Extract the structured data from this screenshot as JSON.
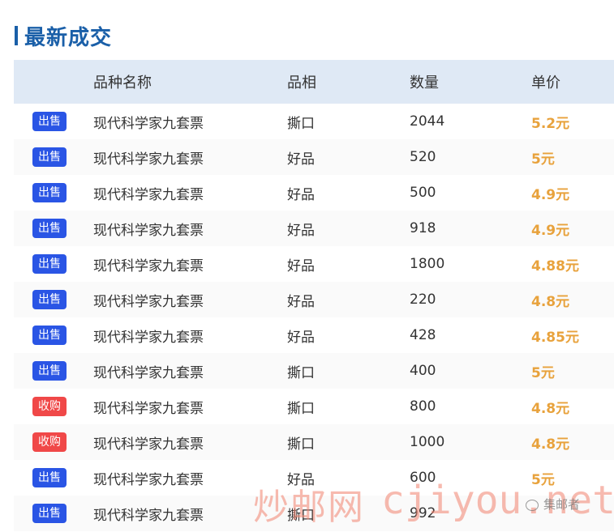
{
  "section": {
    "title": "最新成交"
  },
  "table": {
    "headers": [
      "",
      "品种名称",
      "品相",
      "数量",
      "单价"
    ],
    "rows": [
      {
        "type": "出售",
        "color": "#2a55e5",
        "name": "现代科学家九套票",
        "condition": "撕口",
        "qty": "2044",
        "price": "5.2元"
      },
      {
        "type": "出售",
        "color": "#2a55e5",
        "name": "现代科学家九套票",
        "condition": "好品",
        "qty": "520",
        "price": "5元"
      },
      {
        "type": "出售",
        "color": "#2a55e5",
        "name": "现代科学家九套票",
        "condition": "好品",
        "qty": "500",
        "price": "4.9元"
      },
      {
        "type": "出售",
        "color": "#2a55e5",
        "name": "现代科学家九套票",
        "condition": "好品",
        "qty": "918",
        "price": "4.9元"
      },
      {
        "type": "出售",
        "color": "#2a55e5",
        "name": "现代科学家九套票",
        "condition": "好品",
        "qty": "1800",
        "price": "4.88元"
      },
      {
        "type": "出售",
        "color": "#2a55e5",
        "name": "现代科学家九套票",
        "condition": "好品",
        "qty": "220",
        "price": "4.8元"
      },
      {
        "type": "出售",
        "color": "#2a55e5",
        "name": "现代科学家九套票",
        "condition": "好品",
        "qty": "428",
        "price": "4.85元"
      },
      {
        "type": "出售",
        "color": "#2a55e5",
        "name": "现代科学家九套票",
        "condition": "撕口",
        "qty": "400",
        "price": "5元"
      },
      {
        "type": "收购",
        "color": "#f04848",
        "name": "现代科学家九套票",
        "condition": "撕口",
        "qty": "800",
        "price": "4.8元"
      },
      {
        "type": "收购",
        "color": "#f04848",
        "name": "现代科学家九套票",
        "condition": "撕口",
        "qty": "1000",
        "price": "4.8元"
      },
      {
        "type": "出售",
        "color": "#2a55e5",
        "name": "现代科学家九套票",
        "condition": "好品",
        "qty": "600",
        "price": "5元"
      },
      {
        "type": "出售",
        "color": "#2a55e5",
        "name": "现代科学家九套票",
        "condition": "撕口",
        "qty": "992",
        "price": ""
      }
    ]
  },
  "watermark": {
    "cn": "炒邮网",
    "url": "cjiyou.net",
    "source": "集邮者"
  },
  "colors": {
    "accent": "#1a5fa8",
    "header_bg": "#dfe9f5",
    "price": "#e8a23c"
  }
}
